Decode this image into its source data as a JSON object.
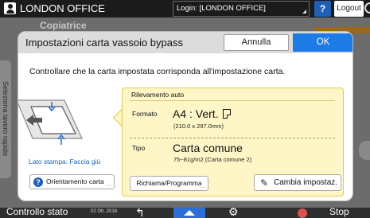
{
  "topbar": {
    "device_name": "LONDON OFFICE",
    "login": "Login: [LONDON OFFICE]",
    "help_label": "?",
    "logout_label": "Logout"
  },
  "background": {
    "app_title": "Copiatrice",
    "side_tab_label": "Seleziona lavoro rapido"
  },
  "dialog": {
    "title": "Impostazioni carta vassoio bypass",
    "cancel_label": "Annulla",
    "ok_label": "OK",
    "message": "Controllare che la carta impostata corrisponda all'impostazione carta.",
    "tray_label": "Lato stampa: Faccia giù",
    "orientation_button": "Orientamento carta",
    "orientation_icon_glyph": "?",
    "panel": {
      "header": "Rilevamento auto",
      "size_label": "Formato",
      "size_value": "A4 : Vert.",
      "size_detail": "(210.0 x 297.0mm)",
      "type_label": "Tipo",
      "type_value": "Carta comune",
      "type_detail": "75~81g/m2 (Carta comune 2)"
    },
    "recall_button": "Richiama/Programma",
    "change_button": "Cambia impostaz.",
    "more_dots": "..."
  },
  "bottombar": {
    "status_label": "Controllo stato",
    "date": "02 Ott. 2018",
    "stop_label": "Stop"
  },
  "colors": {
    "accent_blue": "#1d7be8",
    "panel_yellow": "#fff6c8",
    "panel_border": "#e7c74e",
    "link_blue": "#1a63b7"
  },
  "icons": [
    "user-icon",
    "power-icon",
    "help-icon",
    "doc-portrait-icon",
    "question-icon",
    "pencil-icon",
    "back-icon",
    "home-icon",
    "gear-icon",
    "stop-icon"
  ]
}
